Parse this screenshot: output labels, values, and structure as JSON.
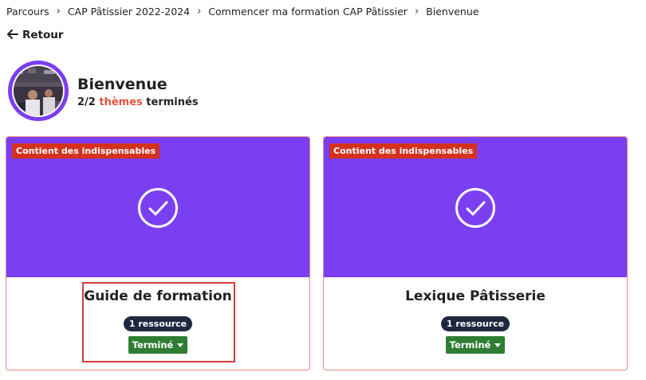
{
  "breadcrumb": {
    "items": [
      "Parcours",
      "CAP Pâtissier 2022-2024",
      "Commencer ma formation CAP Pâtissier",
      "Bienvenue"
    ],
    "separator": "›"
  },
  "back": {
    "icon": "arrow-left-icon",
    "label": "Retour"
  },
  "header": {
    "title": "Bienvenue",
    "progress_count": "2/2",
    "progress_accent": "thèmes",
    "progress_suffix": "terminés"
  },
  "cards": [
    {
      "tag": "Contient des indispensables",
      "icon": "check-circle-icon",
      "title": "Guide de formation",
      "resources": "1 ressource",
      "status": "Terminé"
    },
    {
      "tag": "Contient des indispensables",
      "icon": "check-circle-icon",
      "title": "Lexique Pâtisserie",
      "resources": "1 ressource",
      "status": "Terminé"
    }
  ],
  "colors": {
    "primary": "#7b3ff2",
    "tag": "#d5311f",
    "status": "#2e7d32",
    "pill": "#1e2940",
    "accent_text": "#e3533a"
  }
}
